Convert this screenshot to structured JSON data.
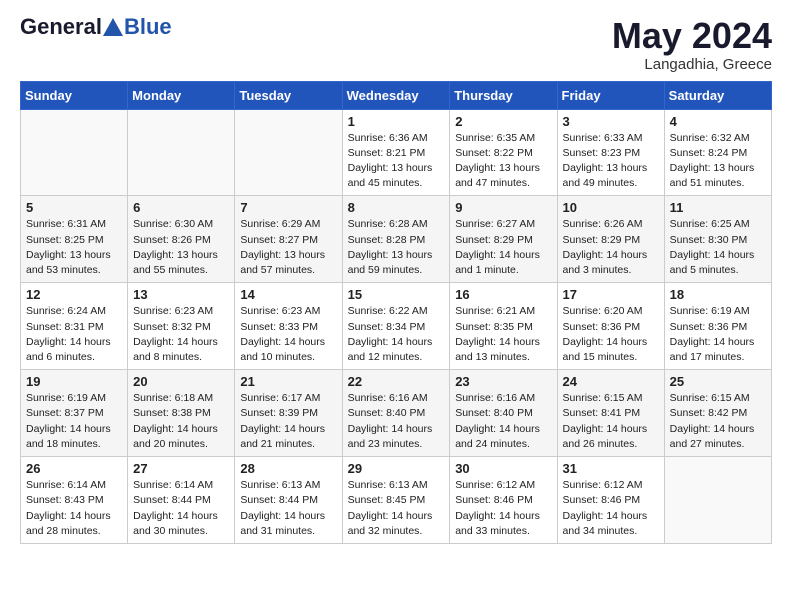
{
  "header": {
    "logo_general": "General",
    "logo_blue": "Blue",
    "month_year": "May 2024",
    "location": "Langadhia, Greece"
  },
  "weekdays": [
    "Sunday",
    "Monday",
    "Tuesday",
    "Wednesday",
    "Thursday",
    "Friday",
    "Saturday"
  ],
  "weeks": [
    [
      {
        "day": "",
        "sunrise": "",
        "sunset": "",
        "daylight": ""
      },
      {
        "day": "",
        "sunrise": "",
        "sunset": "",
        "daylight": ""
      },
      {
        "day": "",
        "sunrise": "",
        "sunset": "",
        "daylight": ""
      },
      {
        "day": "1",
        "sunrise": "Sunrise: 6:36 AM",
        "sunset": "Sunset: 8:21 PM",
        "daylight": "Daylight: 13 hours and 45 minutes."
      },
      {
        "day": "2",
        "sunrise": "Sunrise: 6:35 AM",
        "sunset": "Sunset: 8:22 PM",
        "daylight": "Daylight: 13 hours and 47 minutes."
      },
      {
        "day": "3",
        "sunrise": "Sunrise: 6:33 AM",
        "sunset": "Sunset: 8:23 PM",
        "daylight": "Daylight: 13 hours and 49 minutes."
      },
      {
        "day": "4",
        "sunrise": "Sunrise: 6:32 AM",
        "sunset": "Sunset: 8:24 PM",
        "daylight": "Daylight: 13 hours and 51 minutes."
      }
    ],
    [
      {
        "day": "5",
        "sunrise": "Sunrise: 6:31 AM",
        "sunset": "Sunset: 8:25 PM",
        "daylight": "Daylight: 13 hours and 53 minutes."
      },
      {
        "day": "6",
        "sunrise": "Sunrise: 6:30 AM",
        "sunset": "Sunset: 8:26 PM",
        "daylight": "Daylight: 13 hours and 55 minutes."
      },
      {
        "day": "7",
        "sunrise": "Sunrise: 6:29 AM",
        "sunset": "Sunset: 8:27 PM",
        "daylight": "Daylight: 13 hours and 57 minutes."
      },
      {
        "day": "8",
        "sunrise": "Sunrise: 6:28 AM",
        "sunset": "Sunset: 8:28 PM",
        "daylight": "Daylight: 13 hours and 59 minutes."
      },
      {
        "day": "9",
        "sunrise": "Sunrise: 6:27 AM",
        "sunset": "Sunset: 8:29 PM",
        "daylight": "Daylight: 14 hours and 1 minute."
      },
      {
        "day": "10",
        "sunrise": "Sunrise: 6:26 AM",
        "sunset": "Sunset: 8:29 PM",
        "daylight": "Daylight: 14 hours and 3 minutes."
      },
      {
        "day": "11",
        "sunrise": "Sunrise: 6:25 AM",
        "sunset": "Sunset: 8:30 PM",
        "daylight": "Daylight: 14 hours and 5 minutes."
      }
    ],
    [
      {
        "day": "12",
        "sunrise": "Sunrise: 6:24 AM",
        "sunset": "Sunset: 8:31 PM",
        "daylight": "Daylight: 14 hours and 6 minutes."
      },
      {
        "day": "13",
        "sunrise": "Sunrise: 6:23 AM",
        "sunset": "Sunset: 8:32 PM",
        "daylight": "Daylight: 14 hours and 8 minutes."
      },
      {
        "day": "14",
        "sunrise": "Sunrise: 6:23 AM",
        "sunset": "Sunset: 8:33 PM",
        "daylight": "Daylight: 14 hours and 10 minutes."
      },
      {
        "day": "15",
        "sunrise": "Sunrise: 6:22 AM",
        "sunset": "Sunset: 8:34 PM",
        "daylight": "Daylight: 14 hours and 12 minutes."
      },
      {
        "day": "16",
        "sunrise": "Sunrise: 6:21 AM",
        "sunset": "Sunset: 8:35 PM",
        "daylight": "Daylight: 14 hours and 13 minutes."
      },
      {
        "day": "17",
        "sunrise": "Sunrise: 6:20 AM",
        "sunset": "Sunset: 8:36 PM",
        "daylight": "Daylight: 14 hours and 15 minutes."
      },
      {
        "day": "18",
        "sunrise": "Sunrise: 6:19 AM",
        "sunset": "Sunset: 8:36 PM",
        "daylight": "Daylight: 14 hours and 17 minutes."
      }
    ],
    [
      {
        "day": "19",
        "sunrise": "Sunrise: 6:19 AM",
        "sunset": "Sunset: 8:37 PM",
        "daylight": "Daylight: 14 hours and 18 minutes."
      },
      {
        "day": "20",
        "sunrise": "Sunrise: 6:18 AM",
        "sunset": "Sunset: 8:38 PM",
        "daylight": "Daylight: 14 hours and 20 minutes."
      },
      {
        "day": "21",
        "sunrise": "Sunrise: 6:17 AM",
        "sunset": "Sunset: 8:39 PM",
        "daylight": "Daylight: 14 hours and 21 minutes."
      },
      {
        "day": "22",
        "sunrise": "Sunrise: 6:16 AM",
        "sunset": "Sunset: 8:40 PM",
        "daylight": "Daylight: 14 hours and 23 minutes."
      },
      {
        "day": "23",
        "sunrise": "Sunrise: 6:16 AM",
        "sunset": "Sunset: 8:40 PM",
        "daylight": "Daylight: 14 hours and 24 minutes."
      },
      {
        "day": "24",
        "sunrise": "Sunrise: 6:15 AM",
        "sunset": "Sunset: 8:41 PM",
        "daylight": "Daylight: 14 hours and 26 minutes."
      },
      {
        "day": "25",
        "sunrise": "Sunrise: 6:15 AM",
        "sunset": "Sunset: 8:42 PM",
        "daylight": "Daylight: 14 hours and 27 minutes."
      }
    ],
    [
      {
        "day": "26",
        "sunrise": "Sunrise: 6:14 AM",
        "sunset": "Sunset: 8:43 PM",
        "daylight": "Daylight: 14 hours and 28 minutes."
      },
      {
        "day": "27",
        "sunrise": "Sunrise: 6:14 AM",
        "sunset": "Sunset: 8:44 PM",
        "daylight": "Daylight: 14 hours and 30 minutes."
      },
      {
        "day": "28",
        "sunrise": "Sunrise: 6:13 AM",
        "sunset": "Sunset: 8:44 PM",
        "daylight": "Daylight: 14 hours and 31 minutes."
      },
      {
        "day": "29",
        "sunrise": "Sunrise: 6:13 AM",
        "sunset": "Sunset: 8:45 PM",
        "daylight": "Daylight: 14 hours and 32 minutes."
      },
      {
        "day": "30",
        "sunrise": "Sunrise: 6:12 AM",
        "sunset": "Sunset: 8:46 PM",
        "daylight": "Daylight: 14 hours and 33 minutes."
      },
      {
        "day": "31",
        "sunrise": "Sunrise: 6:12 AM",
        "sunset": "Sunset: 8:46 PM",
        "daylight": "Daylight: 14 hours and 34 minutes."
      },
      {
        "day": "",
        "sunrise": "",
        "sunset": "",
        "daylight": ""
      }
    ]
  ]
}
